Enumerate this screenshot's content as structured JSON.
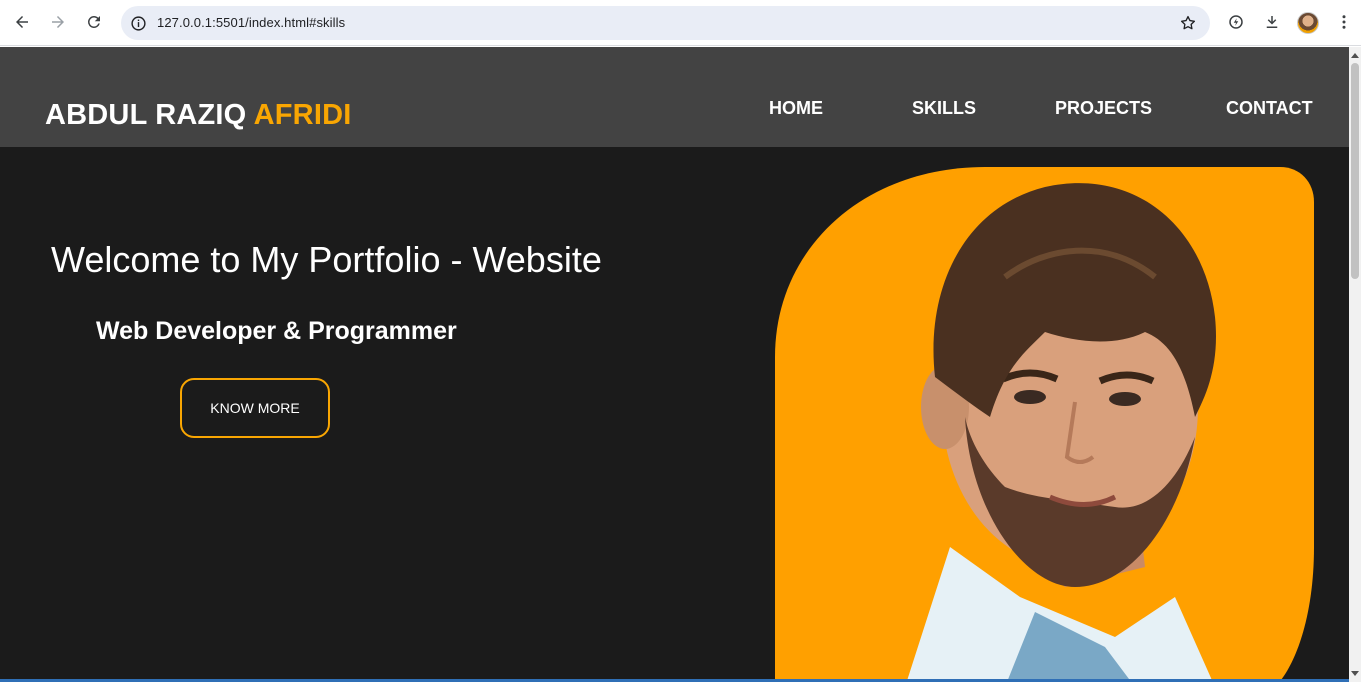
{
  "browser": {
    "url": "127.0.0.1:5501/index.html#skills",
    "icons": [
      "back-arrow-icon",
      "forward-arrow-icon",
      "reload-icon",
      "site-info-icon",
      "bookmark-star-icon",
      "extensions-icon",
      "download-icon",
      "profile-avatar",
      "more-menu-icon"
    ]
  },
  "header": {
    "logo_first": "ABDUL RAZIQ",
    "logo_accent": "AFRIDI",
    "nav": [
      {
        "label": "HOME"
      },
      {
        "label": "SKILLS"
      },
      {
        "label": "PROJECTS"
      },
      {
        "label": "CONTACT"
      }
    ]
  },
  "hero": {
    "title": "Welcome to My Portfolio - Website",
    "subtitle": "Web Developer & Programmer",
    "button_label": "KNOW MORE"
  },
  "colors": {
    "accent": "#f9a602",
    "header_bg": "#434343",
    "page_bg": "#1b1b1b",
    "text": "#ffffff"
  }
}
